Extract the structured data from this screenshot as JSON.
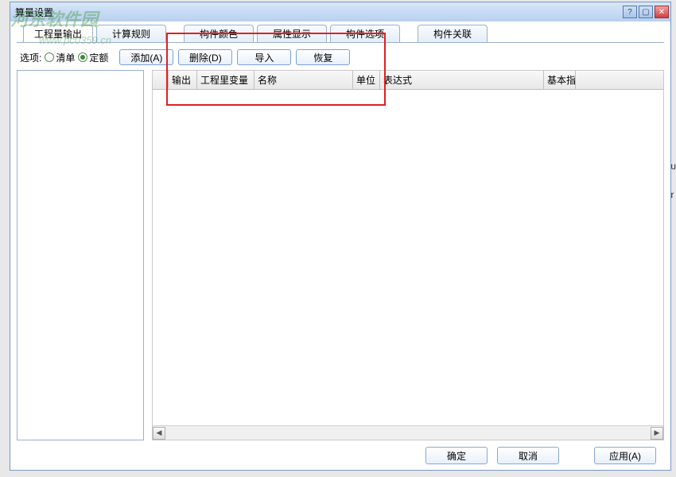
{
  "window": {
    "title": "算量设置"
  },
  "watermark": {
    "text": "河东软件园",
    "url": "www.pc0359.cn"
  },
  "tabs_row1": [
    {
      "label": "工程量输出",
      "active": true
    },
    {
      "label": "计算规则"
    }
  ],
  "tabs_row2": [
    {
      "label": "构件颜色"
    },
    {
      "label": "属性显示"
    },
    {
      "label": "构件选项"
    },
    {
      "label": "构件关联"
    }
  ],
  "options": {
    "label": "选项:",
    "radios": [
      {
        "label": "清单",
        "selected": false
      },
      {
        "label": "定额",
        "selected": true
      }
    ]
  },
  "actions": [
    {
      "label": "添加(A)"
    },
    {
      "label": "删除(D)"
    },
    {
      "label": "导入"
    },
    {
      "label": "恢复"
    }
  ],
  "grid": {
    "headers": {
      "rownum": "",
      "output": "输出",
      "var": "工程里变量",
      "name": "名称",
      "unit": "单位",
      "expr": "表达式",
      "basic": "基本指"
    }
  },
  "footer": {
    "ok": "确定",
    "cancel": "取消",
    "apply": "应用(A)"
  }
}
